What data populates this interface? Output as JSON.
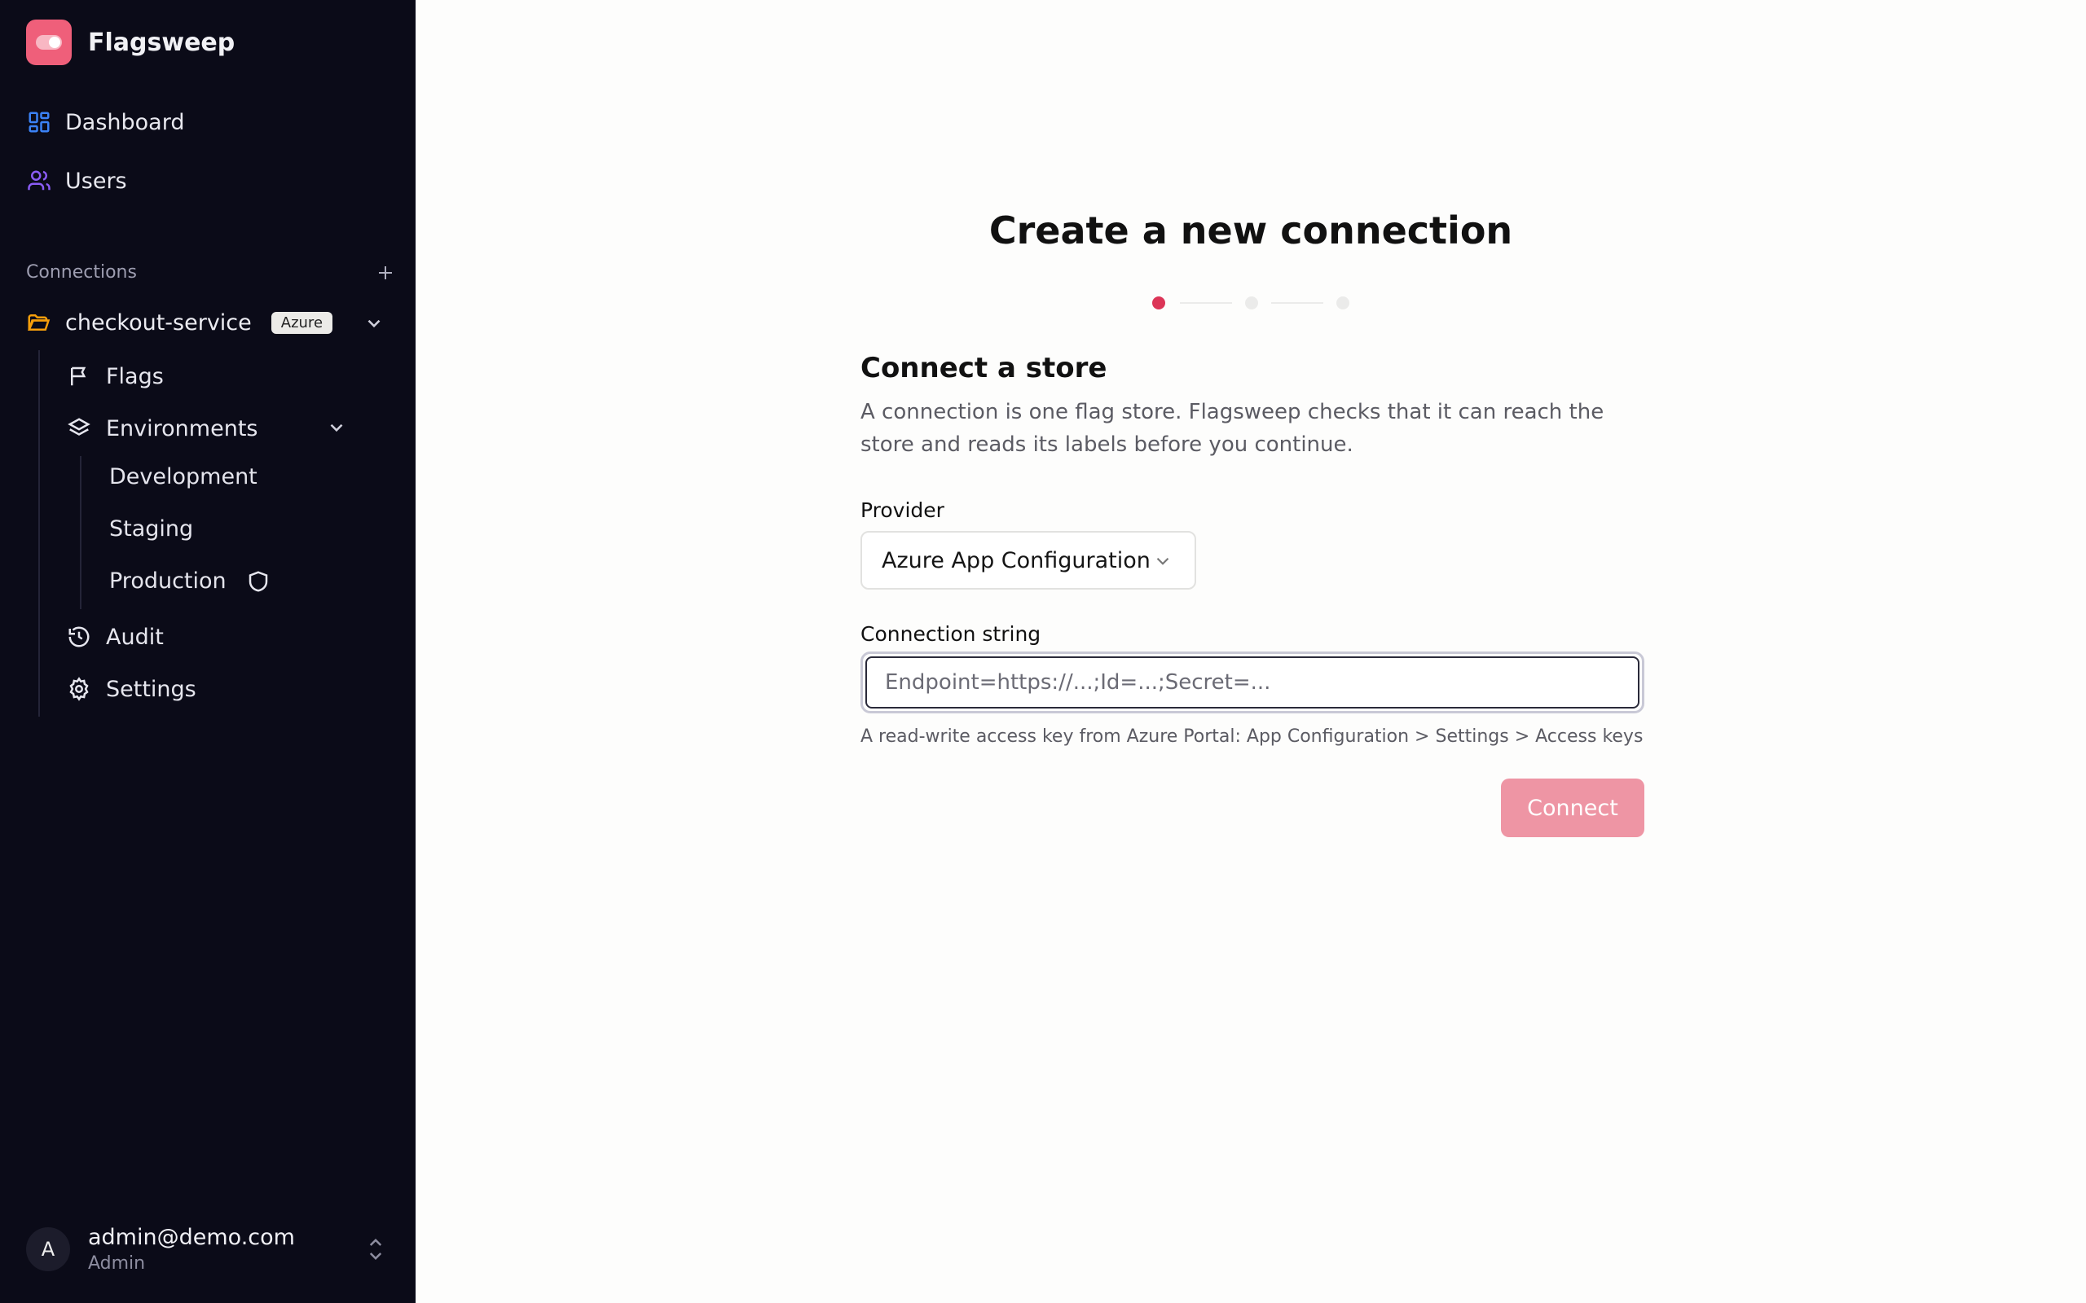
{
  "app": {
    "name": "Flagsweep"
  },
  "sidebar": {
    "nav": [
      {
        "label": "Dashboard"
      },
      {
        "label": "Users"
      }
    ],
    "connections_label": "Connections",
    "connection": {
      "name": "checkout-service",
      "badge": "Azure",
      "items": [
        {
          "label": "Flags"
        },
        {
          "label": "Environments"
        },
        {
          "label": "Audit"
        },
        {
          "label": "Settings"
        }
      ],
      "environments": [
        {
          "label": "Development"
        },
        {
          "label": "Staging"
        },
        {
          "label": "Production"
        }
      ]
    },
    "user": {
      "initial": "A",
      "email": "admin@demo.com",
      "role": "Admin"
    }
  },
  "main": {
    "title": "Create a new connection",
    "steps": {
      "current": 1,
      "total": 3
    },
    "section_title": "Connect a store",
    "description": "A connection is one flag store. Flagsweep checks that it can reach the store and reads its labels before you continue.",
    "provider_label": "Provider",
    "provider_value": "Azure App Configuration",
    "connection_string_label": "Connection string",
    "connection_string_placeholder": "Endpoint=https://...;Id=...;Secret=...",
    "hint": "A read-write access key from Azure Portal: App Configuration > Settings > Access keys",
    "connect_label": "Connect"
  },
  "colors": {
    "sidebar_bg": "#0b0b18",
    "brand": "#ef5f7a",
    "step_active": "#dc3557",
    "button_disabled": "#ee95a4"
  }
}
